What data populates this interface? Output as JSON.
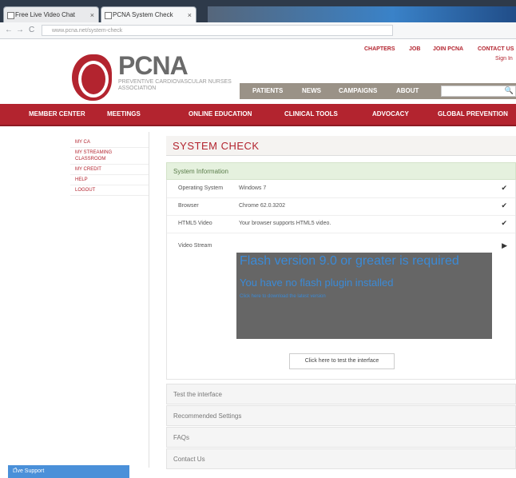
{
  "browser": {
    "tabs": [
      {
        "label": "Free Live Video Chat"
      },
      {
        "label": "PCNA System Check"
      }
    ],
    "url": "www.pcna.net/system-check",
    "back": "←",
    "forward": "→",
    "reload": "C"
  },
  "header": {
    "brand": "PCNA",
    "tagline": "PREVENTIVE CARDIOVASCULAR NURSES ASSOCIATION",
    "top_links": [
      "CHAPTERS",
      "JOB",
      "JOIN PCNA",
      "CONTACT US"
    ],
    "sign_in": "Sign In",
    "gray_nav": [
      "PATIENTS",
      "NEWS",
      "CAMPAIGNS",
      "ABOUT"
    ],
    "search_icon": "🔍",
    "red_nav": [
      "MEMBER CENTER",
      "MEETINGS",
      "ONLINE EDUCATION",
      "CLINICAL TOOLS",
      "ADVOCACY",
      "GLOBAL PREVENTION"
    ]
  },
  "sidebar": {
    "items": [
      "MY CA",
      "MY STREAMING CLASSROOM",
      "MY CREDIT",
      "HELP",
      "LOGOUT"
    ]
  },
  "main": {
    "title": "SYSTEM CHECK",
    "panel_title": "System Information",
    "rows": [
      {
        "label": "Operating System",
        "value": "Windows 7",
        "check": "✔"
      },
      {
        "label": "Browser",
        "value": "Chrome 62.0.3202",
        "check": "✔"
      },
      {
        "label": "HTML5 Video",
        "value": "Your browser supports HTML5 video.",
        "check": "✔"
      },
      {
        "label": "Video Stream",
        "value": "",
        "check": "▶"
      }
    ],
    "flash": {
      "heading": "Flash version 9.0 or greater is required",
      "sub": "You have no flash plugin installed",
      "link": "Click here to download the latest version"
    },
    "test_button": "Click here to test the interface",
    "sections": [
      "Test the interface",
      "Recommended Settings",
      "FAQs",
      "Contact Us"
    ]
  },
  "support": {
    "label": "Live Support",
    "chevron": "⌃"
  }
}
